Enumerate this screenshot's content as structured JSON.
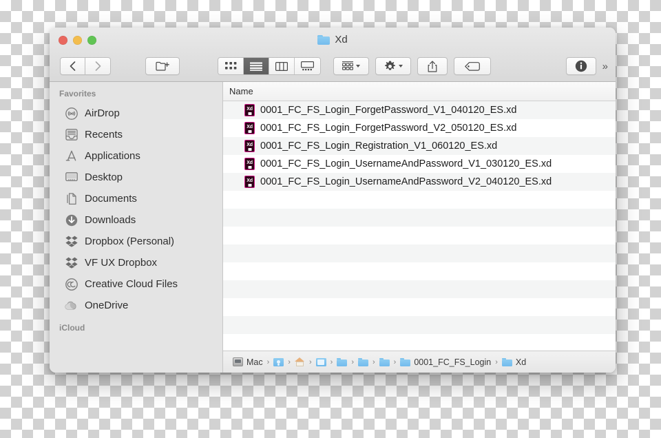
{
  "window": {
    "title": "Xd",
    "title_icon": "folder-icon",
    "traffic_lights": [
      {
        "name": "close",
        "color": "#e9685f"
      },
      {
        "name": "minimize",
        "color": "#f3bd4e"
      },
      {
        "name": "maximize",
        "color": "#61c454"
      }
    ]
  },
  "toolbar": {
    "back_label": "‹",
    "forward_label": "›",
    "new_folder_icon": "new-folder-icon",
    "view_modes": [
      {
        "name": "icon-view",
        "icon": "grid-icon",
        "active": false
      },
      {
        "name": "list-view",
        "icon": "list-icon",
        "active": true
      },
      {
        "name": "column-view",
        "icon": "columns-icon",
        "active": false
      },
      {
        "name": "gallery-view",
        "icon": "gallery-icon",
        "active": false
      }
    ],
    "arrange_icon": "group-by-icon",
    "action_icon": "gear-icon",
    "share_icon": "share-icon",
    "tag_icon": "tag-icon",
    "info_icon": "info-icon",
    "overflow_label": "»"
  },
  "sidebar": {
    "sections": [
      {
        "header": "Favorites",
        "items": [
          {
            "label": "AirDrop",
            "icon": "airdrop-icon"
          },
          {
            "label": "Recents",
            "icon": "recents-icon"
          },
          {
            "label": "Applications",
            "icon": "applications-icon"
          },
          {
            "label": "Desktop",
            "icon": "desktop-icon"
          },
          {
            "label": "Documents",
            "icon": "documents-icon"
          },
          {
            "label": "Downloads",
            "icon": "downloads-icon"
          },
          {
            "label": "Dropbox (Personal)",
            "icon": "dropbox-icon"
          },
          {
            "label": "VF UX Dropbox",
            "icon": "dropbox-icon"
          },
          {
            "label": "Creative Cloud Files",
            "icon": "creative-cloud-icon"
          },
          {
            "label": "OneDrive",
            "icon": "onedrive-icon"
          }
        ]
      },
      {
        "header": "iCloud",
        "items": []
      }
    ]
  },
  "file_list": {
    "columns": [
      "Name"
    ],
    "rows": [
      {
        "name": "0001_FC_FS_Login_ForgetPassword_V1_040120_ES.xd",
        "icon": "xd-file-icon"
      },
      {
        "name": "0001_FC_FS_Login_ForgetPassword_V2_050120_ES.xd",
        "icon": "xd-file-icon"
      },
      {
        "name": "0001_FC_FS_Login_Registration_V1_060120_ES.xd",
        "icon": "xd-file-icon"
      },
      {
        "name": "0001_FC_FS_Login_UsernameAndPassword_V1_030120_ES.xd",
        "icon": "xd-file-icon"
      },
      {
        "name": "0001_FC_FS_Login_UsernameAndPassword_V2_040120_ES.xd",
        "icon": "xd-file-icon"
      }
    ],
    "empty_row_count": 9
  },
  "path_bar": {
    "separator": "›",
    "crumbs": [
      {
        "label": "Mac",
        "icon": "hard-drive-icon",
        "truncated": true
      },
      {
        "label": "",
        "icon": "users-folder-icon"
      },
      {
        "label": "",
        "icon": "home-icon"
      },
      {
        "label": "",
        "icon": "open-folder-icon"
      },
      {
        "label": "",
        "icon": "folder-icon"
      },
      {
        "label": "",
        "icon": "folder-icon"
      },
      {
        "label": "",
        "icon": "folder-icon"
      },
      {
        "label": "0001_FC_FS_Login",
        "icon": "folder-icon"
      },
      {
        "label": "Xd",
        "icon": "folder-icon"
      }
    ]
  },
  "colors": {
    "sidebar_bg": "#e4e4e4",
    "row_stripe": "#f4f5f5",
    "xd_accent": "#d41f8d",
    "xd_dark": "#2e0018",
    "folder_blue": "#8ecdf2",
    "view_active": "#6d6d6d"
  }
}
